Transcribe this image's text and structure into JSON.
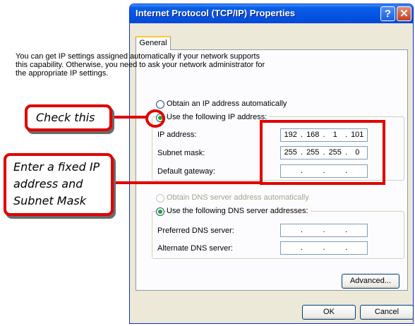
{
  "window": {
    "title": "Internet Protocol (TCP/IP) Properties",
    "help_glyph": "?",
    "close_glyph": "✕",
    "tab_general": "General",
    "description": "You can get IP settings assigned automatically if your network supports this capability. Otherwise, you need to ask your network administrator for the appropriate IP settings.",
    "ip_options": {
      "auto_label": "Obtain an IP address automatically",
      "manual_label": "Use the following IP address:",
      "selected": "manual"
    },
    "ip_fields": [
      {
        "label": "IP address:",
        "octets": [
          "192",
          "168",
          "1",
          "101"
        ]
      },
      {
        "label": "Subnet mask:",
        "octets": [
          "255",
          "255",
          "255",
          "0"
        ]
      },
      {
        "label": "Default gateway:",
        "octets": [
          "",
          "",
          "",
          ""
        ]
      }
    ],
    "dns_options": {
      "auto_label": "Obtain DNS server address automatically",
      "manual_label": "Use the following DNS server addresses:",
      "selected": "manual"
    },
    "dns_fields": [
      {
        "label": "Preferred DNS server:",
        "octets": [
          "",
          "",
          "",
          ""
        ]
      },
      {
        "label": "Alternate DNS server:",
        "octets": [
          "",
          "",
          "",
          ""
        ]
      }
    ],
    "advanced_button": "Advanced...",
    "ok_button": "OK",
    "cancel_button": "Cancel"
  },
  "annotations": {
    "callout1": "Check this",
    "callout2": "Enter a fixed IP address and Subnet Mask",
    "highlight_color": "#e00000"
  }
}
